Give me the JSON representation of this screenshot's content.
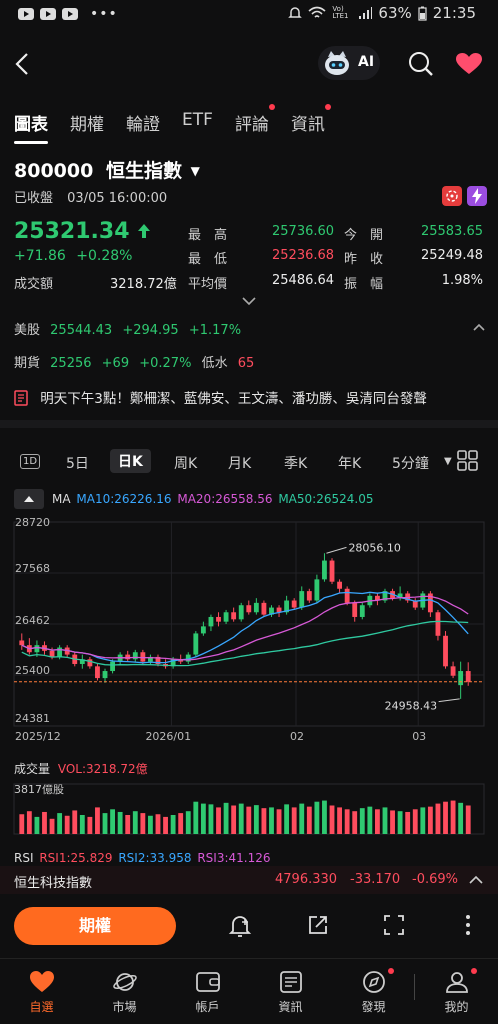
{
  "status": {
    "battery": "63%",
    "time": "21:35",
    "net": "Vo) LTE1"
  },
  "tabs": [
    {
      "label": "圖表",
      "active": true,
      "dot": false
    },
    {
      "label": "期權",
      "active": false,
      "dot": false
    },
    {
      "label": "輪證",
      "active": false,
      "dot": false
    },
    {
      "label": "ETF",
      "active": false,
      "dot": false
    },
    {
      "label": "評論",
      "active": false,
      "dot": true
    },
    {
      "label": "資訊",
      "active": false,
      "dot": true
    }
  ],
  "ai_label": "AI",
  "quote": {
    "code": "800000",
    "name": "恒生指數",
    "status": "已收盤",
    "datetime": "03/05 16:00:00",
    "price": "25321.34",
    "change": "+71.86",
    "change_pct": "+0.28%",
    "turnover_label": "成交額",
    "turnover": "3218.72億",
    "high_label": "最　高",
    "high": "25736.60",
    "low_label": "最　低",
    "low": "25236.68",
    "avg_label": "平均價",
    "avg": "25486.64",
    "open_label": "今　開",
    "open": "25583.65",
    "prev_label": "昨　收",
    "prev": "25249.48",
    "amp_label": "振　幅",
    "amp": "1.98%"
  },
  "us": {
    "label": "美股",
    "value": "25544.43",
    "change": "+294.95",
    "pct": "+1.17%"
  },
  "futures": {
    "label": "期貨",
    "value": "25256",
    "change": "+69",
    "pct": "+0.27%",
    "discount_label": "低水",
    "discount": "65"
  },
  "news": "明天下午3點！鄭柵潔、藍佛安、王文濤、潘功勝、吳清同台發聲",
  "periods": [
    "1D",
    "5日",
    "日K",
    "周K",
    "月K",
    "季K",
    "年K",
    "5分鐘"
  ],
  "ma": {
    "label": "MA",
    "ma10": "MA10:26226.16",
    "ma20": "MA20:26558.56",
    "ma50": "MA50:26524.05"
  },
  "chart_data": {
    "type": "candlestick",
    "y_ticks": [
      "28720",
      "27568",
      "26462",
      "25400",
      "24381"
    ],
    "x_ticks": [
      "2025/12",
      "2026/01",
      "02",
      "03"
    ],
    "annotations": [
      "28056.10",
      "24958.43"
    ],
    "ylim": [
      24381,
      28720
    ],
    "candles": [
      [
        26200,
        26100,
        26350,
        26000
      ],
      [
        26100,
        25950,
        26250,
        25900
      ],
      [
        25950,
        26100,
        26200,
        25850
      ],
      [
        26100,
        25980,
        26180,
        25900
      ],
      [
        25980,
        25850,
        26050,
        25800
      ],
      [
        25850,
        26050,
        26100,
        25800
      ],
      [
        26050,
        25900,
        26100,
        25850
      ],
      [
        25900,
        25700,
        25950,
        25650
      ],
      [
        25700,
        25800,
        25900,
        25600
      ],
      [
        25800,
        25650,
        25850,
        25600
      ],
      [
        25650,
        25400,
        25700,
        25350
      ],
      [
        25400,
        25550,
        25600,
        25300
      ],
      [
        25550,
        25750,
        25800,
        25500
      ],
      [
        25750,
        25900,
        25950,
        25700
      ],
      [
        25900,
        25800,
        25980,
        25750
      ],
      [
        25800,
        25950,
        26000,
        25750
      ],
      [
        25950,
        25750,
        26000,
        25700
      ],
      [
        25750,
        25850,
        25900,
        25700
      ],
      [
        25850,
        25700,
        25900,
        25650
      ],
      [
        25700,
        25650,
        25800,
        25600
      ],
      [
        25650,
        25800,
        25850,
        25600
      ],
      [
        25800,
        25750,
        25900,
        25700
      ],
      [
        25750,
        25900,
        25950,
        25700
      ],
      [
        25900,
        26350,
        26400,
        25850
      ],
      [
        26350,
        26500,
        26600,
        26300
      ],
      [
        26500,
        26700,
        26750,
        26400
      ],
      [
        26700,
        26600,
        26800,
        26500
      ],
      [
        26600,
        26800,
        26850,
        26550
      ],
      [
        26800,
        26650,
        26900,
        26600
      ],
      [
        26650,
        26950,
        27000,
        26600
      ],
      [
        26950,
        26800,
        27050,
        26750
      ],
      [
        26800,
        27000,
        27100,
        26750
      ],
      [
        27000,
        26750,
        27050,
        26700
      ],
      [
        26750,
        26900,
        26950,
        26700
      ],
      [
        26900,
        26800,
        26950,
        26700
      ],
      [
        26800,
        27050,
        27150,
        26750
      ],
      [
        27050,
        26900,
        27100,
        26850
      ],
      [
        26900,
        27250,
        27350,
        26850
      ],
      [
        27250,
        27050,
        27300,
        27000
      ],
      [
        27050,
        27500,
        27600,
        27000
      ],
      [
        27500,
        27900,
        28056,
        27450
      ],
      [
        27900,
        27450,
        27950,
        27400
      ],
      [
        27450,
        27300,
        27500,
        27200
      ],
      [
        27300,
        27000,
        27350,
        26950
      ],
      [
        27000,
        26700,
        27050,
        26600
      ],
      [
        26700,
        26950,
        27000,
        26650
      ],
      [
        26950,
        27150,
        27200,
        26900
      ],
      [
        27150,
        27050,
        27200,
        26950
      ],
      [
        27050,
        27250,
        27300,
        27000
      ],
      [
        27250,
        27100,
        27300,
        27050
      ],
      [
        27100,
        27200,
        27350,
        27050
      ],
      [
        27200,
        27050,
        27250,
        27000
      ],
      [
        27050,
        26900,
        27100,
        26850
      ],
      [
        26900,
        27200,
        27250,
        26850
      ],
      [
        27200,
        26800,
        27250,
        26700
      ],
      [
        26800,
        26300,
        26850,
        26200
      ],
      [
        26300,
        25650,
        26400,
        25600
      ],
      [
        25650,
        25450,
        25750,
        25400
      ],
      [
        25250,
        25550,
        25750,
        24958
      ],
      [
        25550,
        25320,
        25736,
        25236
      ]
    ],
    "volume_label": "成交量",
    "volume_value": "VOL:3218.72億",
    "volume_max": "3817億股",
    "volumes": [
      52,
      60,
      45,
      58,
      40,
      55,
      48,
      62,
      50,
      45,
      70,
      55,
      65,
      58,
      50,
      60,
      55,
      48,
      52,
      45,
      50,
      55,
      60,
      85,
      80,
      78,
      70,
      82,
      75,
      80,
      72,
      76,
      68,
      70,
      65,
      78,
      70,
      80,
      72,
      85,
      88,
      75,
      70,
      65,
      60,
      68,
      72,
      65,
      70,
      62,
      60,
      58,
      65,
      70,
      72,
      80,
      85,
      88,
      82,
      75
    ]
  },
  "rsi": {
    "label": "RSI",
    "rsi1": "RSI1:25.829",
    "rsi2": "RSI2:33.958",
    "rsi3": "RSI3:41.126"
  },
  "ticker": {
    "name": "恒生科技指數",
    "value": "4796.330",
    "change": "-33.170",
    "pct": "-0.69%"
  },
  "options_button": "期權",
  "bottom_nav": [
    {
      "label": "自選",
      "icon": "heart-icon",
      "active": true
    },
    {
      "label": "市場",
      "icon": "planet-icon",
      "active": false
    },
    {
      "label": "帳戶",
      "icon": "wallet-icon",
      "active": false
    },
    {
      "label": "資訊",
      "icon": "news-icon",
      "active": false
    },
    {
      "label": "發現",
      "icon": "compass-icon",
      "active": false,
      "dot": true
    },
    {
      "label": "我的",
      "icon": "user-icon",
      "active": false,
      "dot": true
    }
  ],
  "colors": {
    "up": "#2fc971",
    "down": "#ff4d5e",
    "accent": "#ff6a2b",
    "ma10": "#39a7ff",
    "ma20": "#d659d6",
    "ma50": "#2fc9a0"
  }
}
